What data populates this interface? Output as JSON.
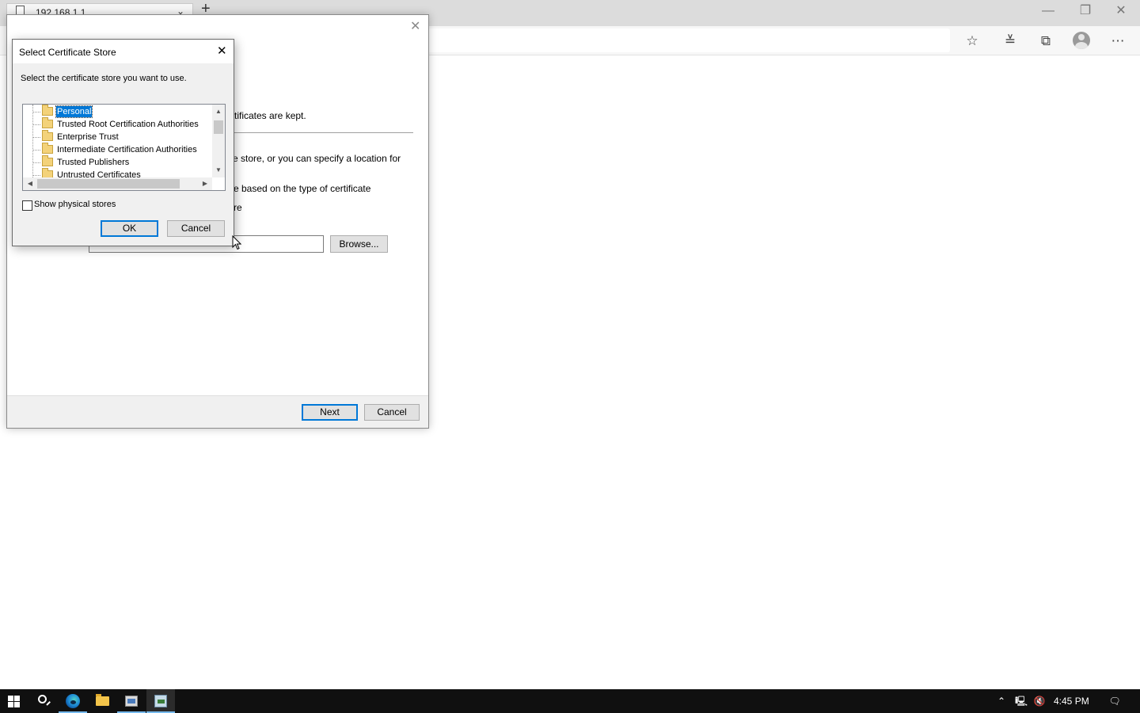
{
  "browser": {
    "tab_title": "192.168.1.1",
    "tab_close_glyph": "⌄",
    "new_tab_glyph": "+",
    "window_controls": {
      "minimize": "—",
      "restore": "❐",
      "close": "✕"
    },
    "toolbar_icons": [
      "star-add-icon",
      "favorites-icon",
      "collections-icon",
      "profile-icon",
      "more-icon"
    ]
  },
  "wizard": {
    "close_glyph": "✕",
    "partial_texts": [
      "rtificates are kept.",
      "e store, or you can specify a location for",
      "e based on the type of certificate",
      "re"
    ],
    "browse_label": "Browse...",
    "next_label": "Next",
    "cancel_label": "Cancel"
  },
  "store_dialog": {
    "title": "Select Certificate Store",
    "close_glyph": "✕",
    "prompt": "Select the certificate store you want to use.",
    "stores": [
      {
        "label": "Personal",
        "selected": true
      },
      {
        "label": "Trusted Root Certification Authorities",
        "selected": false
      },
      {
        "label": "Enterprise Trust",
        "selected": false
      },
      {
        "label": "Intermediate Certification Authorities",
        "selected": false
      },
      {
        "label": "Trusted Publishers",
        "selected": false
      },
      {
        "label": "Untrusted Certificates",
        "selected": false
      }
    ],
    "show_physical_label": "Show physical stores",
    "show_physical_checked": false,
    "ok_label": "OK",
    "cancel_label": "Cancel"
  },
  "taskbar": {
    "apps": [
      "windows-start-icon",
      "search-icon",
      "edge-icon",
      "file-explorer-icon",
      "server-manager-icon",
      "certificate-manager-icon"
    ],
    "tray_icons": [
      "chevron-up-icon",
      "network-icon",
      "volume-muted-icon",
      "notifications-icon"
    ],
    "clock": "4:45 PM"
  },
  "colors": {
    "accent": "#0078d7",
    "taskbar": "#101010",
    "dialog_face": "#f0f0f0"
  }
}
